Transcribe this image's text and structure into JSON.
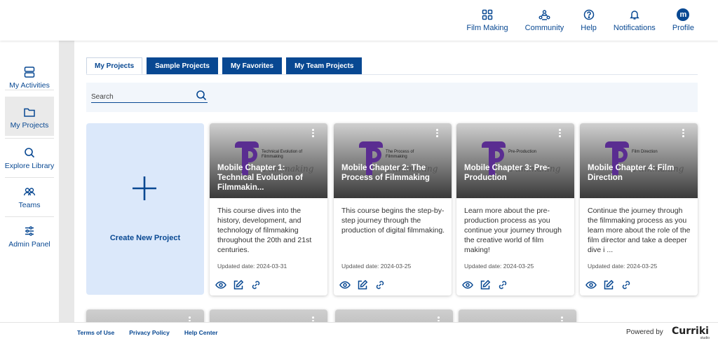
{
  "header": {
    "nav": [
      {
        "label": "Film Making",
        "icon": "grid-icon"
      },
      {
        "label": "Community",
        "icon": "community-icon"
      },
      {
        "label": "Help",
        "icon": "help-icon"
      },
      {
        "label": "Notifications",
        "icon": "bell-icon"
      },
      {
        "label": "Profile",
        "icon": "avatar",
        "avatar_letter": "m"
      }
    ]
  },
  "sidebar": {
    "items": [
      {
        "label": "My Activities",
        "icon": "activities-icon"
      },
      {
        "label": "My Projects",
        "icon": "folder-icon",
        "active": true
      },
      {
        "label": "Explore Library",
        "icon": "search-icon"
      },
      {
        "label": "Teams",
        "icon": "teams-icon"
      },
      {
        "label": "Admin Panel",
        "icon": "sliders-icon"
      }
    ]
  },
  "tabs": [
    {
      "label": "My Projects",
      "active": true
    },
    {
      "label": "Sample Projects"
    },
    {
      "label": "My Favorites"
    },
    {
      "label": "My Team Projects"
    }
  ],
  "search": {
    "placeholder": "Search"
  },
  "create_project": {
    "label": "Create New Project"
  },
  "thumbnail_word": "Filmmaking",
  "projects": [
    {
      "title": "Mobile Chapter 1: Technical Evolution of Filmmakin...",
      "thumb_caption": "Technical Evolution of Filmmaking",
      "description": "This course dives into the history, development, and technology of filmmaking throughout the 20th and 21st centuries.",
      "date": "Updated date: 2024-03-31"
    },
    {
      "title": "Mobile Chapter 2: The Process of Filmmaking",
      "thumb_caption": "The Process of Filmmaking",
      "description": "This course begins the step-by-step journey through the production of digital filmmaking.",
      "date": "Updated date: 2024-03-25"
    },
    {
      "title": "Mobile Chapter 3: Pre-Production",
      "thumb_caption": "Pre-Production",
      "description": "Learn more about the pre-production process as you continue your journey through the creative world of film making!",
      "date": "Updated date: 2024-03-25"
    },
    {
      "title": "Mobile Chapter 4: Film Direction",
      "thumb_caption": "Film Direction",
      "description": "Continue the journey through the filmmaking process as you learn more about the role of the film director and take a deeper dive i ...",
      "date": "Updated date: 2024-03-25"
    }
  ],
  "footer": {
    "links": [
      "Terms of Use",
      "Privacy Policy",
      "Help Center"
    ],
    "powered_by": "Powered by",
    "brand": "Curriki",
    "brand_sub": "studio"
  },
  "colors": {
    "primary": "#084892",
    "create_card_bg": "#dbe8fa",
    "thumb_purple": "#5a2d91"
  }
}
